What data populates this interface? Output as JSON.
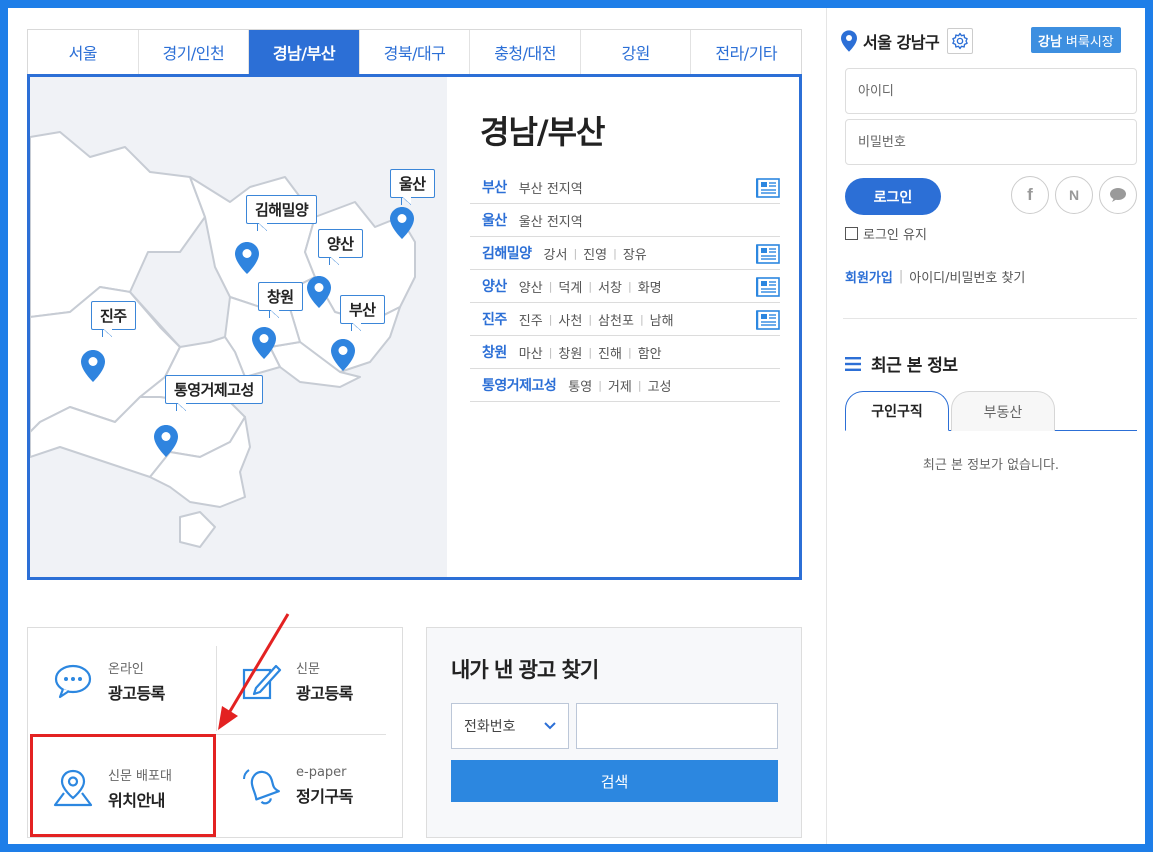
{
  "tabs": [
    {
      "label": "서울",
      "active": false
    },
    {
      "label": "경기/인천",
      "active": false
    },
    {
      "label": "경남/부산",
      "active": true
    },
    {
      "label": "경북/대구",
      "active": false
    },
    {
      "label": "충청/대전",
      "active": false
    },
    {
      "label": "강원",
      "active": false
    },
    {
      "label": "전라/기타",
      "active": false
    }
  ],
  "map": {
    "labels": {
      "ulsan": "울산",
      "gimhae": "김해밀양",
      "yangsan": "양산",
      "changwon": "창원",
      "busan": "부산",
      "jinju": "진주",
      "tongyeong": "통영거제고성"
    }
  },
  "region": {
    "title": "경남/부산",
    "rows": [
      {
        "name": "부산",
        "subs": [
          "부산 전지역"
        ],
        "has_icon": true
      },
      {
        "name": "울산",
        "subs": [
          "울산 전지역"
        ],
        "has_icon": false
      },
      {
        "name": "김해밀양",
        "subs": [
          "강서",
          "진영",
          "장유"
        ],
        "has_icon": true
      },
      {
        "name": "양산",
        "subs": [
          "양산",
          "덕계",
          "서창",
          "화명"
        ],
        "has_icon": true
      },
      {
        "name": "진주",
        "subs": [
          "진주",
          "사천",
          "삼천포",
          "남해"
        ],
        "has_icon": true
      },
      {
        "name": "창원",
        "subs": [
          "마산",
          "창원",
          "진해",
          "함안"
        ],
        "has_icon": false
      },
      {
        "name": "통영거제고성",
        "subs": [
          "통영",
          "거제",
          "고성"
        ],
        "has_icon": false
      }
    ]
  },
  "services": {
    "online": {
      "small": "온라인",
      "big": "광고등록"
    },
    "paper": {
      "small": "신문",
      "big": "광고등록"
    },
    "stand": {
      "small": "신문 배포대",
      "big": "위치안내"
    },
    "epaper": {
      "small": "e-paper",
      "big": "정기구독"
    }
  },
  "ad_search": {
    "title": "내가 낸 광고 찾기",
    "select_value": "전화번호",
    "input_value": "",
    "button": "검색"
  },
  "sidebar": {
    "location": "서울 강남구",
    "badge_bold": "강남",
    "badge_text": "벼룩시장",
    "id_placeholder": "아이디",
    "pw_placeholder": "비밀번호",
    "login_button": "로그인",
    "social": [
      "f",
      "N"
    ],
    "keep_login": "로그인 유지",
    "join": "회원가입",
    "find": "아이디/비밀번호 찾기",
    "recent_title": "최근 본 정보",
    "recent_tabs": [
      "구인구직",
      "부동산"
    ],
    "recent_empty": "최근 본 정보가 없습니다."
  },
  "colors": {
    "accent": "#2c6fd6",
    "frame": "#1e7ee8",
    "highlight": "#e32222"
  }
}
